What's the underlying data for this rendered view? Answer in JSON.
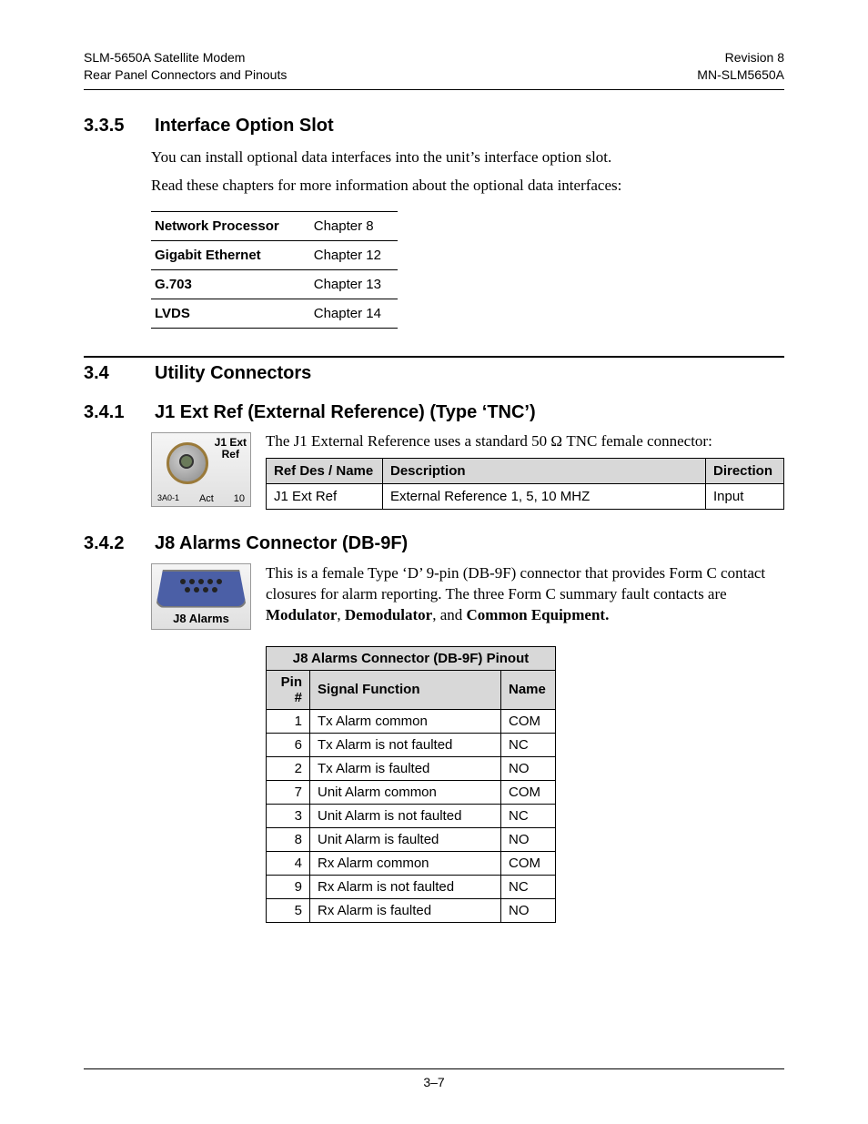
{
  "header": {
    "left1": "SLM-5650A Satellite Modem",
    "left2": "Rear Panel Connectors and Pinouts",
    "right1": "Revision 8",
    "right2": "MN-SLM5650A"
  },
  "s335": {
    "num": "3.3.5",
    "title": "Interface Option Slot",
    "p1": "You can install optional data interfaces into the unit’s interface option slot.",
    "p2": "Read these chapters for more information about the optional data interfaces:",
    "rows": [
      {
        "name": "Network Processor",
        "chap": "Chapter 8"
      },
      {
        "name": "Gigabit Ethernet",
        "chap": "Chapter 12"
      },
      {
        "name": "G.703",
        "chap": "Chapter 13"
      },
      {
        "name": "LVDS",
        "chap": "Chapter 14"
      }
    ]
  },
  "s34": {
    "num": "3.4",
    "title": "Utility Connectors"
  },
  "s341": {
    "num": "3.4.1",
    "title": "J1 Ext Ref (External Reference) (Type ‘TNC’)",
    "lead": "The J1 External Reference uses a standard 50 Ω TNC female connector:",
    "img_lbl_top": "J1 Ext",
    "img_lbl_top2": "Ref",
    "img_lbl_bl": "Act",
    "img_lbl_br": "10",
    "img_lbl_corner": "3A0-1",
    "th1": "Ref Des / Name",
    "th2": "Description",
    "th3": "Direction",
    "r1c1": "J1 Ext Ref",
    "r1c2": "External Reference 1, 5, 10 MHZ",
    "r1c3": "Input"
  },
  "s342": {
    "num": "3.4.2",
    "title": "J8 Alarms Connector (DB-9F)",
    "lead_a": "This is a female Type ‘D’ 9-pin (DB-9F) connector that provides Form C contact closures for alarm reporting. The three Form C summary fault contacts are ",
    "lead_b1": "Modulator",
    "lead_sep1": ", ",
    "lead_b2": "Demodulator",
    "lead_sep2": ", and ",
    "lead_b3": "Common Equipment.",
    "img_cap": "J8 Alarms",
    "tbl_title": "J8 Alarms Connector (DB-9F) Pinout",
    "th_pin": "Pin #",
    "th_sig": "Signal Function",
    "th_name": "Name",
    "rows": [
      {
        "pin": "1",
        "sig": "Tx Alarm common",
        "name": "COM"
      },
      {
        "pin": "6",
        "sig": "Tx Alarm is not faulted",
        "name": "NC"
      },
      {
        "pin": "2",
        "sig": "Tx Alarm is faulted",
        "name": "NO"
      },
      {
        "pin": "7",
        "sig": "Unit Alarm common",
        "name": "COM"
      },
      {
        "pin": "3",
        "sig": "Unit Alarm is not faulted",
        "name": "NC"
      },
      {
        "pin": "8",
        "sig": "Unit Alarm is faulted",
        "name": "NO"
      },
      {
        "pin": "4",
        "sig": "Rx Alarm common",
        "name": "COM"
      },
      {
        "pin": "9",
        "sig": "Rx Alarm is not faulted",
        "name": "NC"
      },
      {
        "pin": "5",
        "sig": "Rx Alarm is faulted",
        "name": "NO"
      }
    ]
  },
  "footer": {
    "page": "3–7"
  }
}
